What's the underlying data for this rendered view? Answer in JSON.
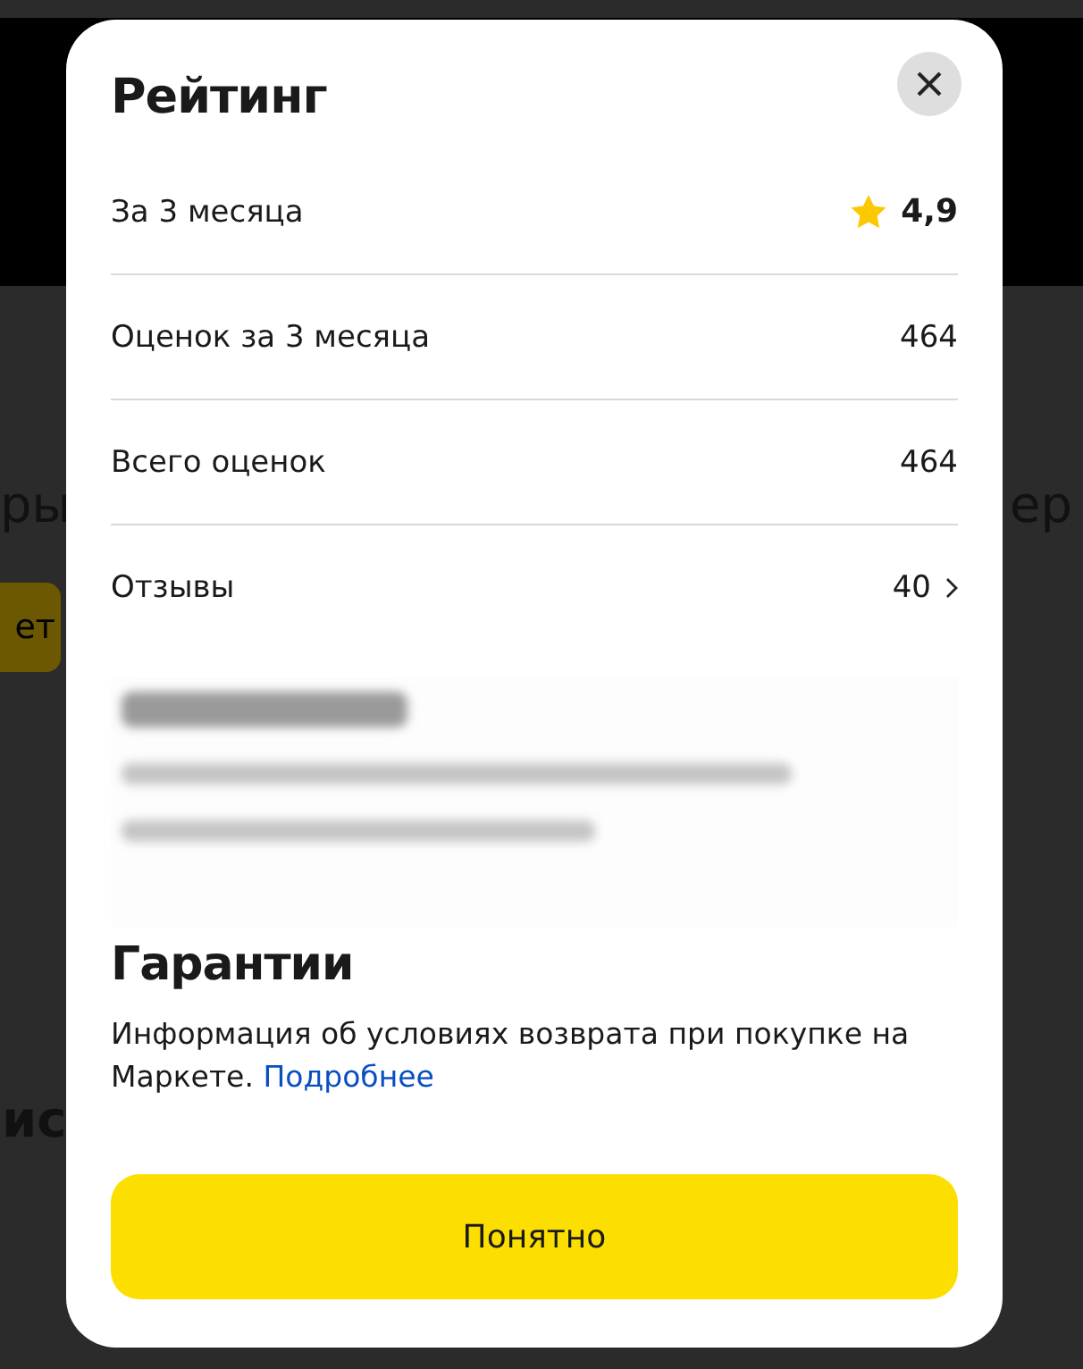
{
  "background": {
    "left_heading": "ры",
    "right_heading": "ер",
    "button": "ет",
    "lower_heading": "ис"
  },
  "dialog": {
    "title": "Рейтинг",
    "rows": [
      {
        "kind": "star",
        "label": "За 3 месяца",
        "value": "4,9"
      },
      {
        "kind": "plain",
        "label": "Оценок за 3 месяца",
        "value": "464"
      },
      {
        "kind": "plain",
        "label": "Всего оценок",
        "value": "464"
      },
      {
        "kind": "link",
        "label": "Отзывы",
        "value": "40"
      }
    ],
    "about": {
      "kind": "blurred"
    },
    "guarantee": {
      "title": "Гарантии",
      "text": "Информация об условиях возврата при покупке на Маркете.",
      "link": "Подробнее"
    },
    "button": "Понятно"
  }
}
